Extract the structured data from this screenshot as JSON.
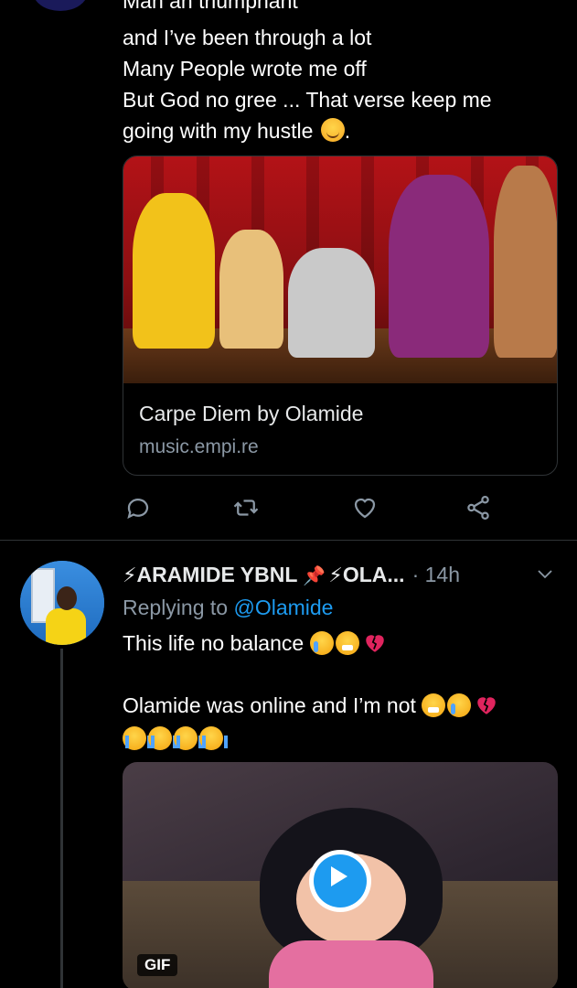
{
  "tweet1": {
    "partial_line": "Man an triumphant",
    "lines": [
      "and I’ve been through a lot",
      "Many People wrote me off",
      "But God no gree ... That verse keep me",
      "going with my hustle"
    ],
    "trailing_punct": ".",
    "card": {
      "title": "Carpe Diem by Olamide",
      "domain": "music.empi.re"
    }
  },
  "actions": [
    "reply-icon",
    "retweet-icon",
    "like-icon",
    "share-icon"
  ],
  "tweet2": {
    "display_name_1": "ARAMIDE YBNL",
    "display_name_2": "OLA...",
    "time": "· 14h",
    "replying_prefix": "Replying to ",
    "replying_handle": "@Olamide",
    "text_line1": "This life no balance",
    "text_line2": "Olamide was online and I’m not",
    "media_badge": "GIF"
  },
  "colors": {
    "link": "#1d9bf0",
    "muted": "#8b98a5",
    "divider": "#2f3336",
    "background": "#000000"
  }
}
